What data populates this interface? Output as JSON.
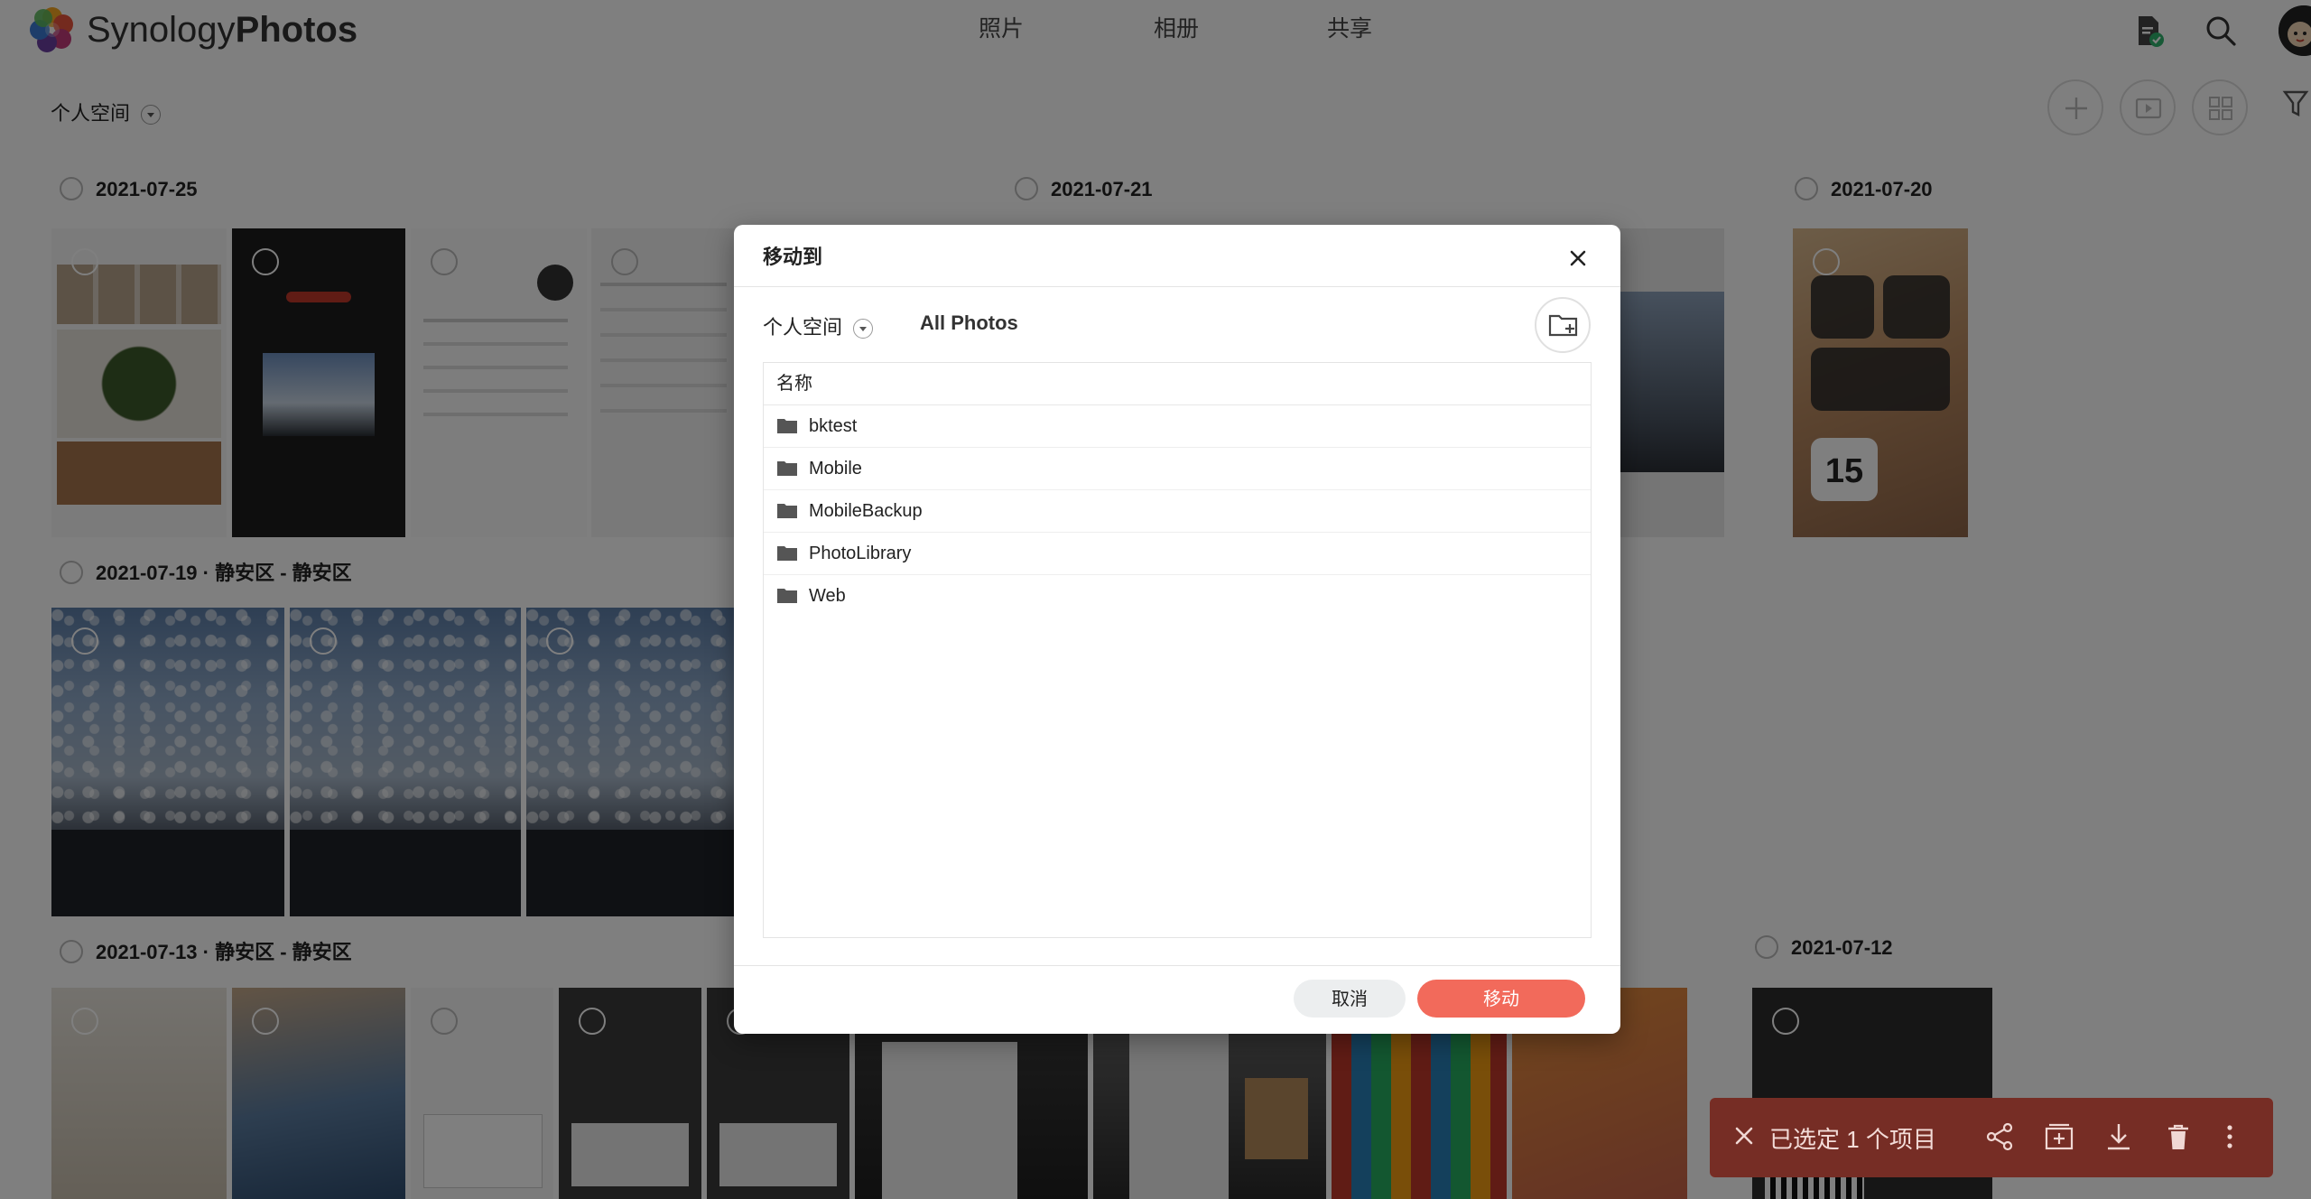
{
  "app": {
    "brand_light": "Synology",
    "brand_bold": "Photos"
  },
  "nav": {
    "tabs": [
      "照片",
      "相册",
      "共享"
    ]
  },
  "toolbar": {
    "space_label": "个人空间"
  },
  "groups": [
    {
      "date": "2021-07-25",
      "location": ""
    },
    {
      "date": "2021-07-21",
      "location": ""
    },
    {
      "date": "2021-07-20",
      "location": ""
    },
    {
      "date": "2021-07-19",
      "location": "静安区 - 静安区"
    },
    {
      "date": "2021-07-13",
      "location": "静安区 - 静安区"
    },
    {
      "date": "2021-07-12",
      "location": ""
    }
  ],
  "thumb_text": {
    "widget_date": "15"
  },
  "dialog": {
    "title": "移动到",
    "space_label": "个人空间",
    "breadcrumb": "All Photos",
    "list_header": "名称",
    "folders": [
      "bktest",
      "Mobile",
      "MobileBackup",
      "PhotoLibrary",
      "Web"
    ],
    "cancel_label": "取消",
    "confirm_label": "移动"
  },
  "selection_bar": {
    "text": "已选定 1 个项目"
  },
  "colors": {
    "accent": "#f26a5b",
    "selection_bar": "#ec5a4b"
  }
}
